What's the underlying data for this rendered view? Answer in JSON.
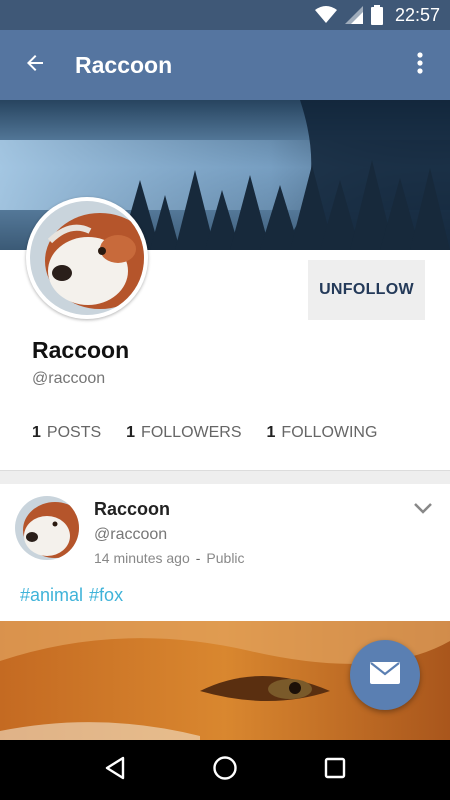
{
  "status_bar": {
    "time": "22:57"
  },
  "app_bar": {
    "title": "Raccoon"
  },
  "profile": {
    "name": "Raccoon",
    "handle": "@raccoon",
    "unfollow_label": "UNFOLLOW",
    "stats": [
      {
        "count": "1",
        "label": "POSTS"
      },
      {
        "count": "1",
        "label": "FOLLOWERS"
      },
      {
        "count": "1",
        "label": "FOLLOWING"
      }
    ]
  },
  "post": {
    "author_name": "Raccoon",
    "author_handle": "@raccoon",
    "time_ago": "14 minutes ago",
    "separator": "-",
    "visibility": "Public",
    "tags": [
      "#animal",
      "#fox"
    ]
  },
  "icons": {
    "back": "arrow-back-icon",
    "menu": "more-vert-icon",
    "expand": "chevron-down-icon",
    "fab": "mail-icon",
    "wifi": "wifi-icon",
    "signal": "signal-icon",
    "battery": "battery-icon"
  },
  "colors": {
    "status_bar": "#3f5877",
    "app_bar": "#5575a0",
    "accent": "#5a7fb2",
    "hashtag": "#3fb3d9"
  }
}
